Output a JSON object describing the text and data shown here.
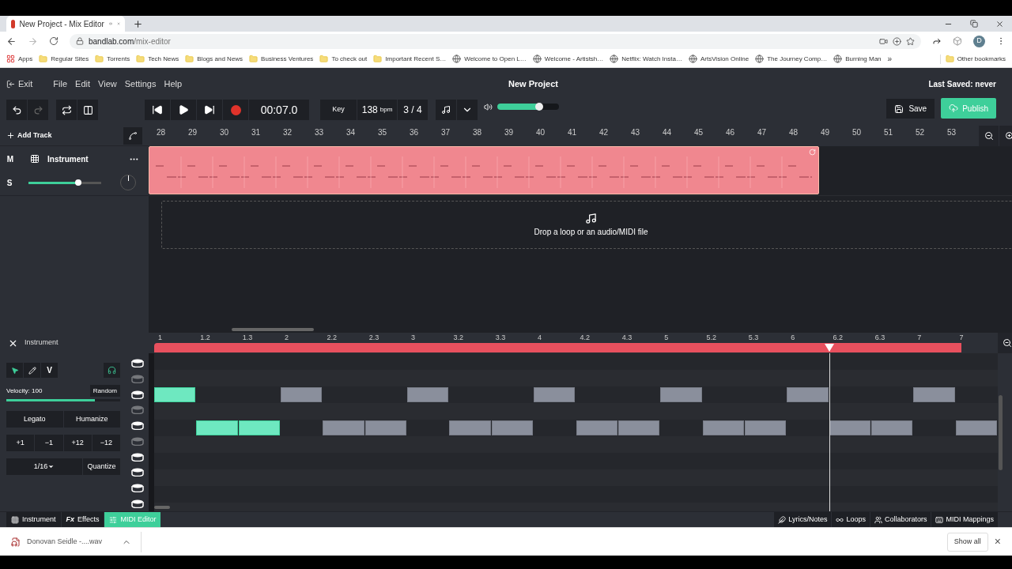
{
  "browser": {
    "tabs": [
      {
        "title": "New Project - Mix Editor",
        "selected": true
      }
    ],
    "url_host": "bandlab.com",
    "url_path": "/mix-editor",
    "profile_initial": "D",
    "bookmarks": [
      {
        "label": "Apps",
        "kind": "apps"
      },
      {
        "label": "Regular Sites",
        "kind": "folder"
      },
      {
        "label": "Torrents",
        "kind": "folder"
      },
      {
        "label": "Tech News",
        "kind": "folder"
      },
      {
        "label": "Blogs and News",
        "kind": "folder"
      },
      {
        "label": "Business Ventures",
        "kind": "folder"
      },
      {
        "label": "To check out",
        "kind": "folder"
      },
      {
        "label": "Important Recent S…",
        "kind": "folder"
      },
      {
        "label": "Welcome to Open L…",
        "kind": "site"
      },
      {
        "label": "Welcome - Artistsh…",
        "kind": "site"
      },
      {
        "label": "Netflix: Watch Insta…",
        "kind": "site"
      },
      {
        "label": "ArtsVision Online",
        "kind": "site"
      },
      {
        "label": "The Journey Comp…",
        "kind": "site"
      },
      {
        "label": "Burning Man",
        "kind": "site"
      }
    ],
    "overflow": "»",
    "other_bookmarks": "Other bookmarks"
  },
  "app": {
    "exit": "Exit",
    "menu": [
      "File",
      "Edit",
      "View",
      "Settings",
      "Help"
    ],
    "project_title": "New Project",
    "last_saved": "Last Saved: never"
  },
  "transport": {
    "time": "00:07.0",
    "key_placeholder": "Key",
    "tempo": "138",
    "tempo_unit": "bpm",
    "signature": "3 / 4",
    "master": {
      "level": 0.68
    },
    "save": "Save",
    "publish": "Publish"
  },
  "arrange": {
    "add_track": "Add Track",
    "bars": [
      "28",
      "29",
      "30",
      "31",
      "32",
      "33",
      "34",
      "35",
      "36",
      "37",
      "38",
      "39",
      "40",
      "41",
      "42",
      "43",
      "44",
      "45",
      "46",
      "47",
      "48",
      "49",
      "50",
      "51",
      "52",
      "53"
    ],
    "tracks": [
      {
        "mute": "M",
        "solo": "S",
        "name": "Instrument",
        "volume": {
          "level": 0.68
        }
      }
    ],
    "drop_hint": "Drop a loop or an audio/MIDI file"
  },
  "midi_editor": {
    "title": "Instrument",
    "tools": [
      {
        "kind": "select",
        "selected": true
      },
      {
        "kind": "pencil",
        "selected": false
      },
      {
        "kind": "velocity",
        "label": "V",
        "selected": false
      }
    ],
    "monitor": {
      "on": true
    },
    "velocity_label": "Velocity: 100",
    "velocity": {
      "level": 0.78
    },
    "random": "Random",
    "legato": "Legato",
    "humanize": "Humanize",
    "transpose": [
      "+1",
      "−1",
      "+12",
      "−12"
    ],
    "grid": "1/16",
    "quantize": "Quantize",
    "ruler": [
      "1",
      "1.2",
      "1.3",
      "2",
      "2.2",
      "2.3",
      "3",
      "3.2",
      "3.3",
      "4",
      "4.2",
      "4.3",
      "5",
      "5.2",
      "5.3",
      "6",
      "6.2",
      "6.3",
      "7",
      "7"
    ],
    "rows": [
      {
        "notes": []
      },
      {
        "notes": []
      },
      {
        "notes": [
          {
            "selected": true
          },
          {
            "selected": false
          },
          {
            "selected": false
          },
          {
            "selected": false
          },
          {
            "selected": false
          },
          {
            "selected": false
          },
          {
            "selected": false
          }
        ]
      },
      {
        "notes": []
      },
      {
        "notes": [
          {
            "selected": true
          },
          {
            "selected": true
          },
          {
            "selected": false
          },
          {
            "selected": false
          },
          {
            "selected": false
          },
          {
            "selected": false
          },
          {
            "selected": false
          },
          {
            "selected": false
          },
          {
            "selected": false
          },
          {
            "selected": false
          },
          {
            "selected": false
          },
          {
            "selected": false
          },
          {
            "selected": false
          }
        ]
      },
      {
        "notes": []
      },
      {
        "notes": []
      },
      {
        "notes": []
      },
      {
        "notes": []
      },
      {
        "notes": []
      }
    ]
  },
  "bottom_tabs": [
    {
      "label": "Instrument",
      "kind": "instrument",
      "selected": false
    },
    {
      "label": "Effects",
      "prefix": "Fx",
      "kind": "effects",
      "selected": false
    },
    {
      "label": "MIDI Editor",
      "kind": "midi",
      "selected": true
    }
  ],
  "side_buttons": [
    {
      "label": "Lyrics/Notes",
      "kind": "lyrics"
    },
    {
      "label": "Loops",
      "kind": "loops"
    },
    {
      "label": "Collaborators",
      "kind": "collaborators"
    },
    {
      "label": "MIDI Mappings",
      "kind": "mappings"
    }
  ],
  "downloads": {
    "file": "Donovan Seidle -....wav",
    "show_all": "Show all",
    "close": "×"
  }
}
